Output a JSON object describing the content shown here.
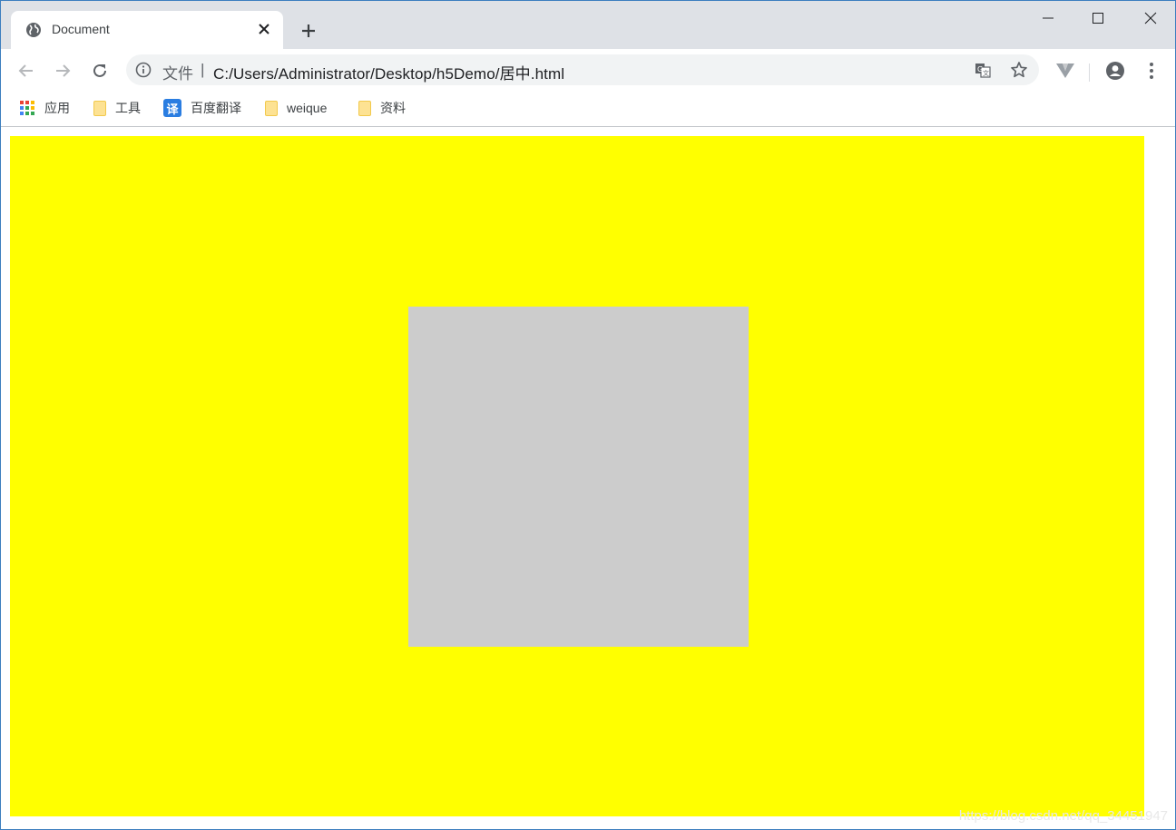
{
  "tab": {
    "title": "Document"
  },
  "omnibox": {
    "scheme_label": "文件",
    "separator": "|",
    "url": "C:/Users/Administrator/Desktop/h5Demo/居中.html"
  },
  "bookmarks": [
    {
      "label": "应用",
      "icon": "apps-grid-icon"
    },
    {
      "label": "工具",
      "icon": "folder-icon"
    },
    {
      "label": "百度翻译",
      "icon": "translate-icon",
      "icon_text": "译"
    },
    {
      "label": "weique",
      "icon": "folder-icon"
    },
    {
      "label": "资料",
      "icon": "folder-icon"
    }
  ],
  "colors": {
    "outer_box": "#ffff00",
    "inner_box": "#cccccc",
    "tabstrip": "#dee1e6",
    "accent": "#2a7de1"
  },
  "watermark": "https://blog.csdn.net/qq_34451947"
}
